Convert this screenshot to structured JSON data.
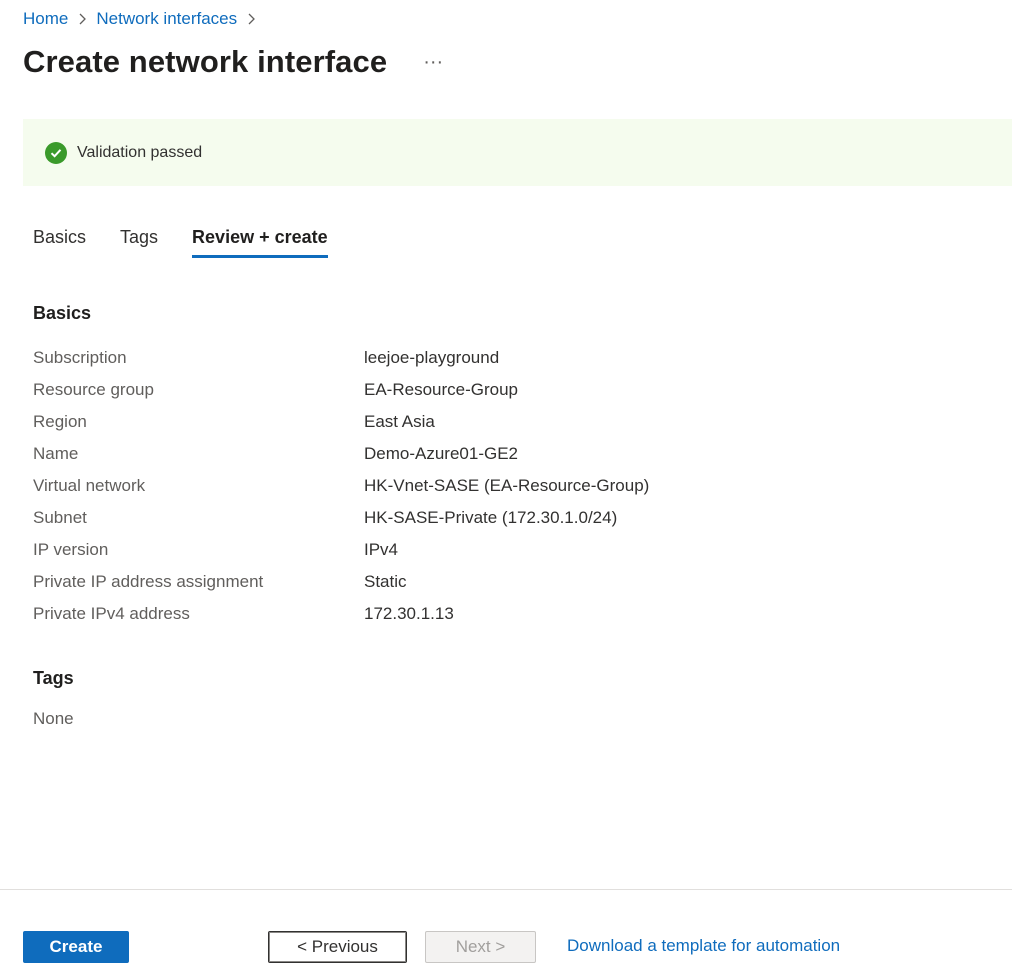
{
  "breadcrumb": {
    "items": [
      {
        "label": "Home"
      },
      {
        "label": "Network interfaces"
      }
    ]
  },
  "page": {
    "title": "Create network interface",
    "more_label": "···"
  },
  "validation": {
    "message": "Validation passed",
    "status": "success",
    "color": "#3a9a2b"
  },
  "tabs": [
    {
      "label": "Basics",
      "active": false
    },
    {
      "label": "Tags",
      "active": false
    },
    {
      "label": "Review + create",
      "active": true
    }
  ],
  "review": {
    "basics_heading": "Basics",
    "basics": [
      {
        "label": "Subscription",
        "value": "leejoe-playground"
      },
      {
        "label": "Resource group",
        "value": "EA-Resource-Group"
      },
      {
        "label": "Region",
        "value": "East Asia"
      },
      {
        "label": "Name",
        "value": "Demo-Azure01-GE2"
      },
      {
        "label": "Virtual network",
        "value": "HK-Vnet-SASE (EA-Resource-Group)"
      },
      {
        "label": "Subnet",
        "value": "HK-SASE-Private (172.30.1.0/24)"
      },
      {
        "label": "IP version",
        "value": "IPv4"
      },
      {
        "label": "Private IP address assignment",
        "value": "Static"
      },
      {
        "label": "Private IPv4 address",
        "value": "172.30.1.13"
      }
    ],
    "tags_heading": "Tags",
    "tags_value": "None"
  },
  "footer": {
    "create_label": "Create",
    "previous_label": "< Previous",
    "next_label": "Next >",
    "download_label": "Download a template for automation"
  },
  "colors": {
    "accent": "#0f6cbd",
    "banner_bg": "#f5fcee"
  }
}
